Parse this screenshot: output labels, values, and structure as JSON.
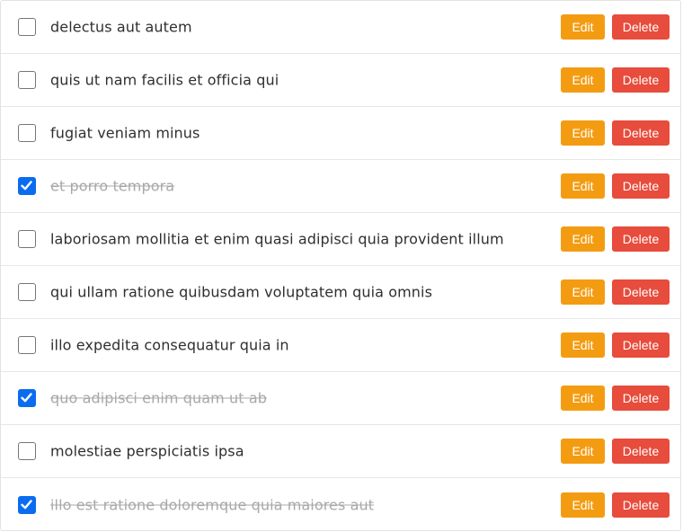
{
  "colors": {
    "edit": "#f39c12",
    "delete": "#e74c3c",
    "checked": "#0b6cf0",
    "done_text": "#a8a8a8"
  },
  "actions": {
    "edit_label": "Edit",
    "delete_label": "Delete"
  },
  "todos": [
    {
      "title": "delectus aut autem",
      "completed": false
    },
    {
      "title": "quis ut nam facilis et officia qui",
      "completed": false
    },
    {
      "title": "fugiat veniam minus",
      "completed": false
    },
    {
      "title": "et porro tempora",
      "completed": true
    },
    {
      "title": "laboriosam mollitia et enim quasi adipisci quia provident illum",
      "completed": false
    },
    {
      "title": "qui ullam ratione quibusdam voluptatem quia omnis",
      "completed": false
    },
    {
      "title": "illo expedita consequatur quia in",
      "completed": false
    },
    {
      "title": "quo adipisci enim quam ut ab",
      "completed": true
    },
    {
      "title": "molestiae perspiciatis ipsa",
      "completed": false
    },
    {
      "title": "illo est ratione doloremque quia maiores aut",
      "completed": true
    }
  ]
}
